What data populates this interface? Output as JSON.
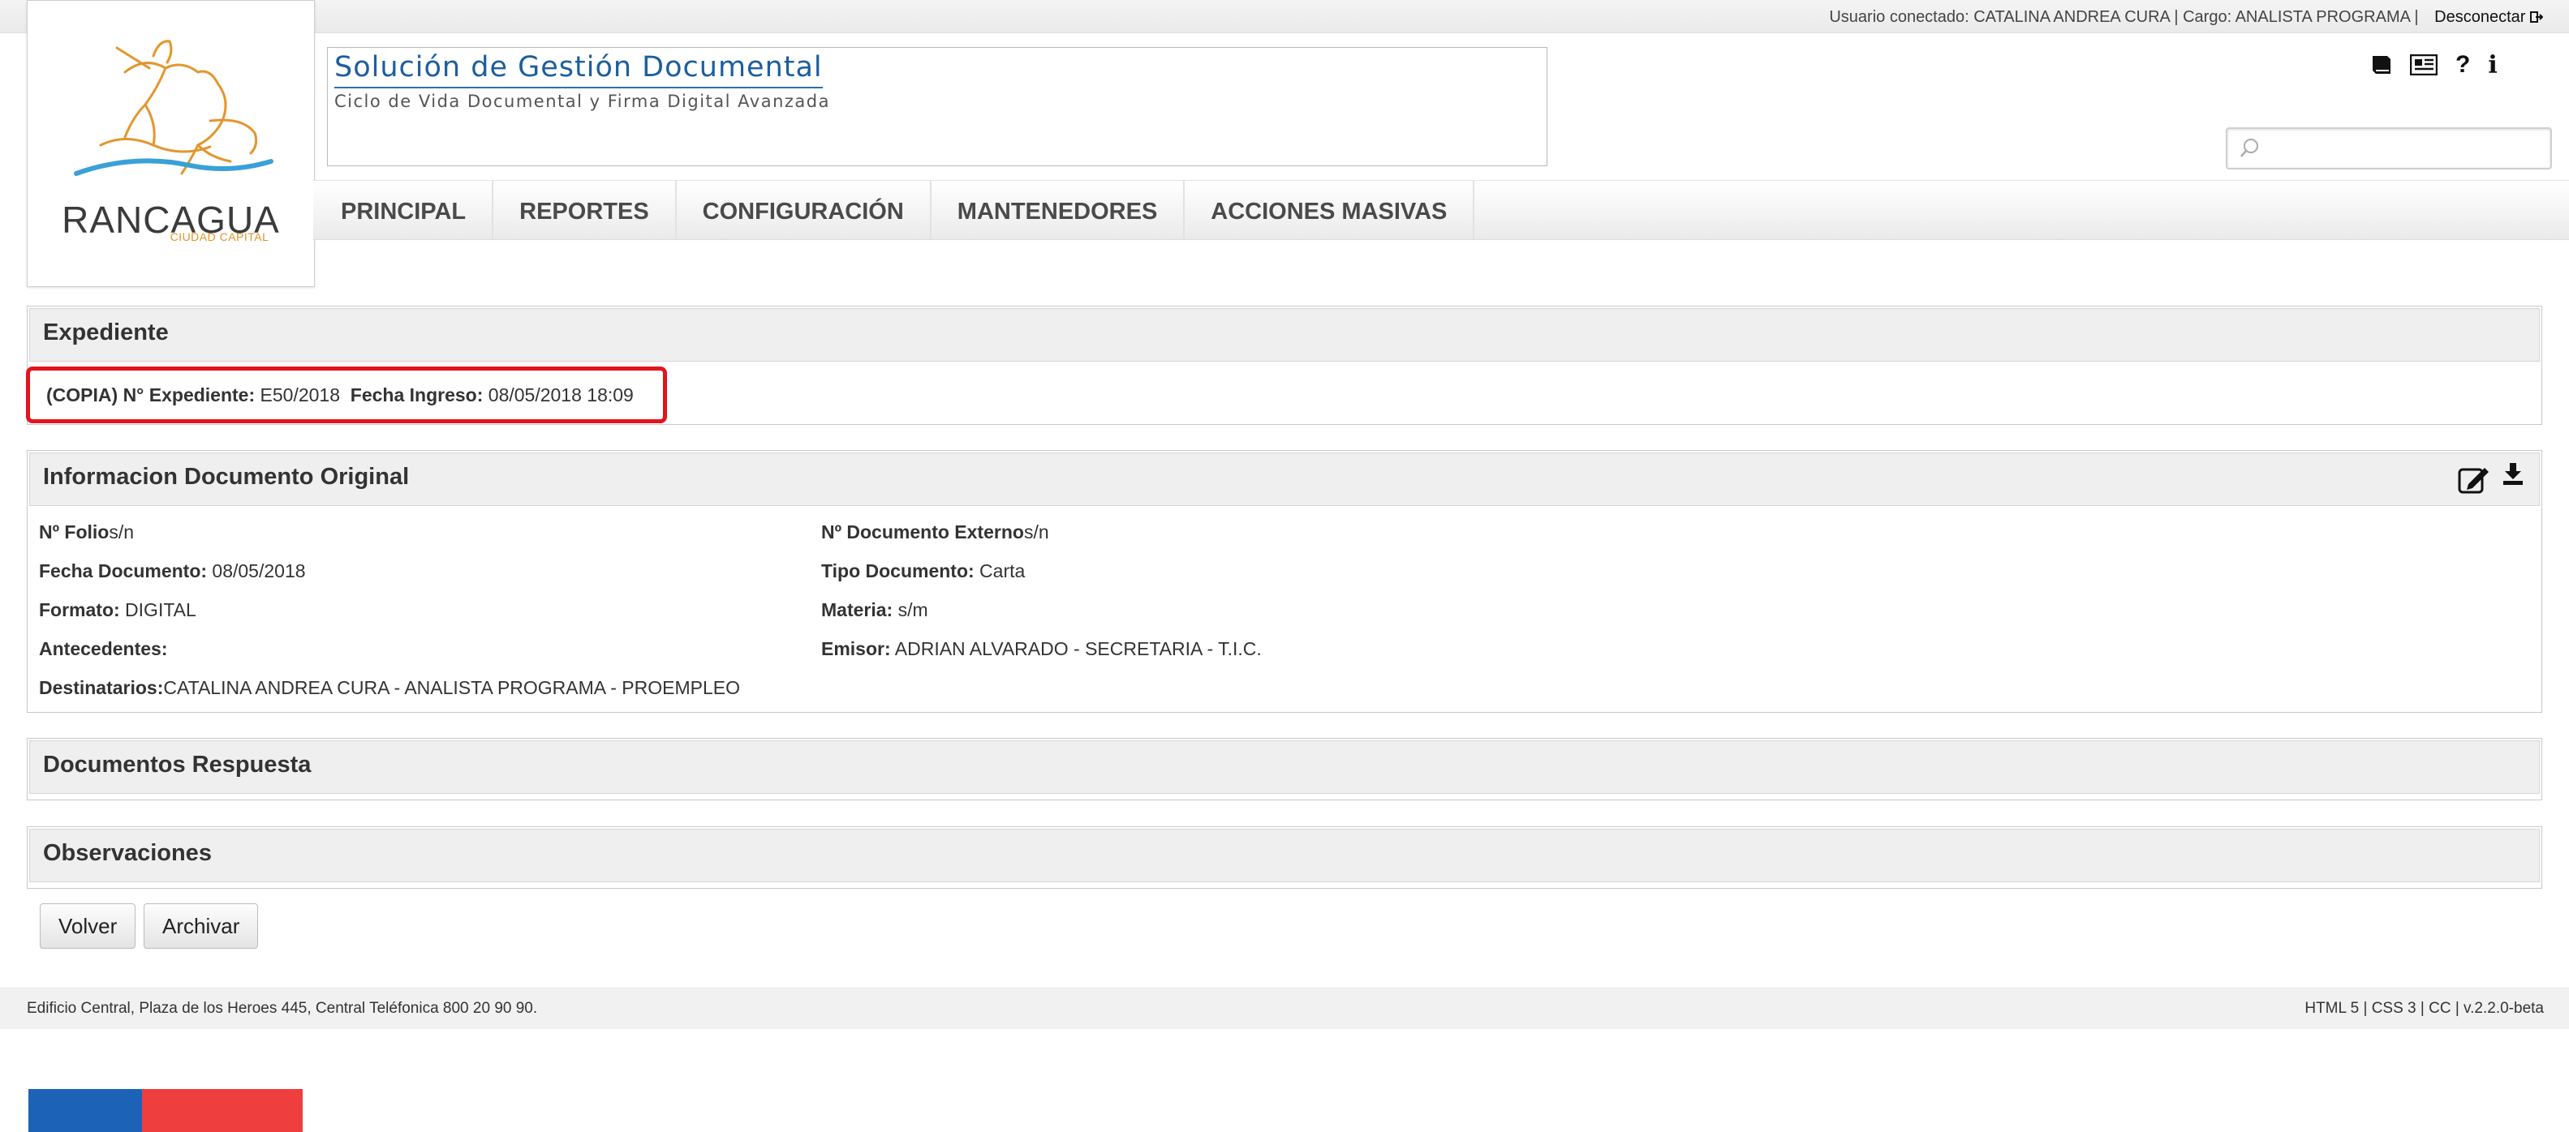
{
  "user_bar": {
    "connected_label": "Usuario conectado:",
    "user_name": "CATALINA ANDREA CURA",
    "role_label": "Cargo:",
    "role": "ANALISTA PROGRAMA",
    "logout_label": "Desconectar"
  },
  "logo": {
    "city": "RANCAGUA",
    "subtitle": "CIUDAD CAPITAL"
  },
  "header": {
    "title": "Solución de Gestión Documental",
    "subtitle": "Ciclo de Vida Documental y Firma Digital Avanzada"
  },
  "toolbar_icons": [
    "book-icon",
    "newspaper-icon",
    "question-icon",
    "info-icon"
  ],
  "search": {
    "placeholder": "",
    "value": ""
  },
  "nav": {
    "items": [
      "PRINCIPAL",
      "REPORTES",
      "CONFIGURACIÓN",
      "MANTENEDORES",
      "ACCIONES MASIVAS"
    ]
  },
  "expediente": {
    "title": "Expediente",
    "copy_tag": "(COPIA)",
    "number_label": "N° Expediente:",
    "number": "E50/2018",
    "date_label": "Fecha Ingreso:",
    "date": "08/05/2018 18:09"
  },
  "original": {
    "title": "Informacion Documento Original",
    "left": [
      {
        "label": "Nº Folio",
        "value": "s/n"
      },
      {
        "label": "Fecha Documento:",
        "value": " 08/05/2018"
      },
      {
        "label": "Formato:",
        "value": " DIGITAL"
      },
      {
        "label": "Antecedentes:",
        "value": ""
      },
      {
        "label": "Destinatarios:",
        "value": "CATALINA ANDREA CURA - ANALISTA PROGRAMA - PROEMPLEO"
      }
    ],
    "right": [
      {
        "label": "Nº Documento Externo",
        "value": "s/n"
      },
      {
        "label": "Tipo Documento:",
        "value": " Carta"
      },
      {
        "label": "Materia:",
        "value": " s/m"
      },
      {
        "label": "Emisor:",
        "value": " ADRIAN ALVARADO - SECRETARIA - T.I.C."
      }
    ]
  },
  "respuestas": {
    "title": "Documentos Respuesta"
  },
  "observaciones": {
    "title": "Observaciones"
  },
  "buttons": {
    "back": "Volver",
    "archive": "Archivar"
  },
  "footer": {
    "address": "Edificio Central, Plaza de los Heroes 445, Central Teléfonica 800 20 90 90.",
    "tech": "HTML 5 | CSS 3 | CC | v.2.2.0-beta"
  },
  "colors": {
    "highlight": "#e3141e",
    "title_blue": "#1c5e9e",
    "flag_blue": "#1c63b7",
    "flag_red": "#ef3e3e"
  }
}
